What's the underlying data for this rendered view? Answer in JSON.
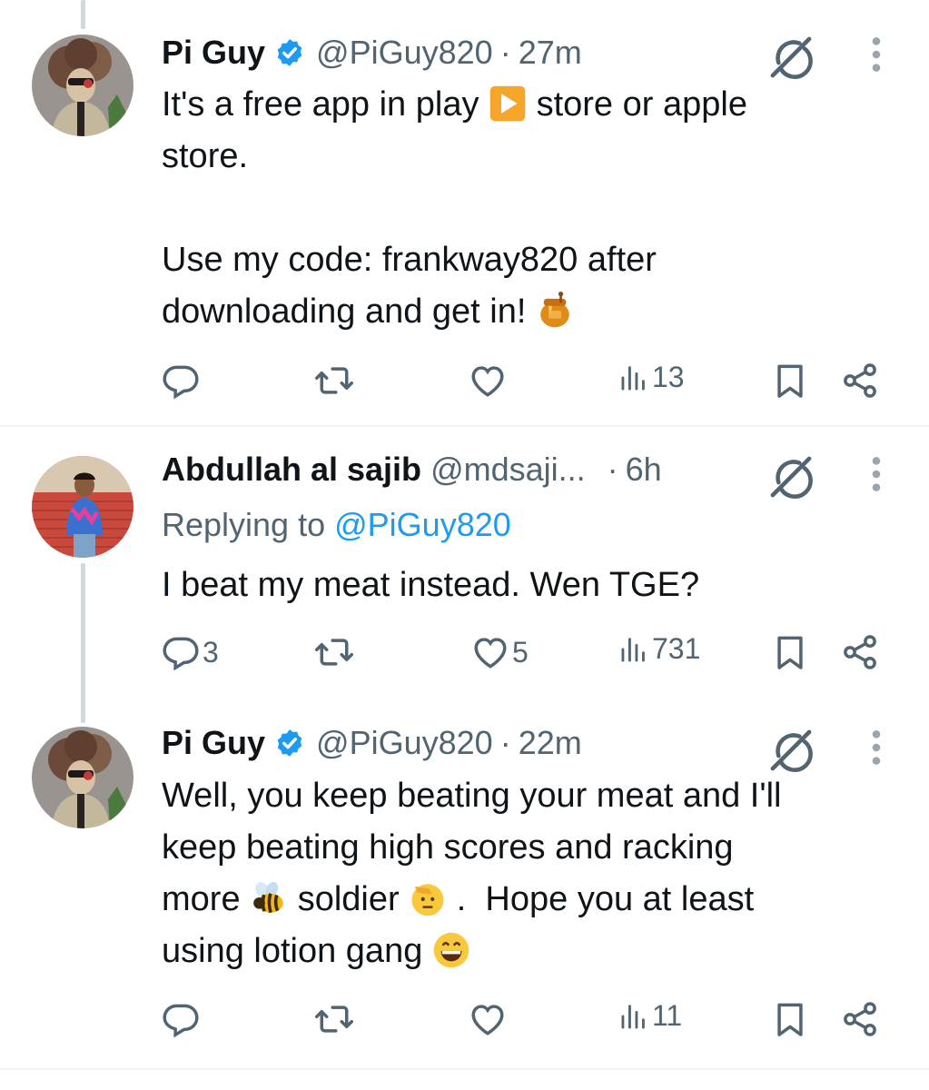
{
  "tweets": [
    {
      "name": "Pi Guy",
      "handle": "@PiGuy820",
      "dot": "·",
      "time": "27m",
      "text_parts": [
        "It's a free app in play ",
        " store or apple\nstore.\n\nUse my code: frankway820 after\ndownloading and get in! "
      ],
      "emojis": [
        "play-button-emoji",
        "honey-pot-emoji"
      ],
      "actions": {
        "replies": "",
        "reposts": "",
        "likes": "",
        "views": "13"
      }
    },
    {
      "name": "Abdullah al sajib",
      "handle": "@mdsaji...",
      "dot": "·",
      "time": "6h",
      "reply_prefix": "Replying to ",
      "reply_mention": "@PiGuy820",
      "text": "I beat my meat instead. Wen TGE?",
      "actions": {
        "replies": "3",
        "reposts": "",
        "likes": "5",
        "views": "731"
      }
    },
    {
      "name": "Pi Guy",
      "handle": "@PiGuy820",
      "dot": "·",
      "time": "22m",
      "text_parts": [
        "Well, you keep beating your meat and I'll\nkeep beating high scores and racking\nmore ",
        " soldier ",
        " .  Hope you at least\nusing lotion gang "
      ],
      "emojis": [
        "honeybee-emoji",
        "saluting-face-emoji",
        "grinning-face-emoji"
      ],
      "actions": {
        "replies": "",
        "reposts": "",
        "likes": "",
        "views": "11"
      }
    }
  ],
  "icons": {
    "reply": "reply-icon",
    "repost": "repost-icon",
    "like": "like-icon",
    "views": "views-icon",
    "bookmark": "bookmark-icon",
    "share": "share-icon",
    "grok": "grok-icon",
    "more": "more-icon",
    "verified": "verified-badge-icon"
  },
  "colors": {
    "text": "#0f1419",
    "secondary": "#536471",
    "link": "#1d9bf0",
    "verified": "#1d9bf0",
    "divider": "#eff3f4",
    "thread_line": "#cfd9de"
  }
}
